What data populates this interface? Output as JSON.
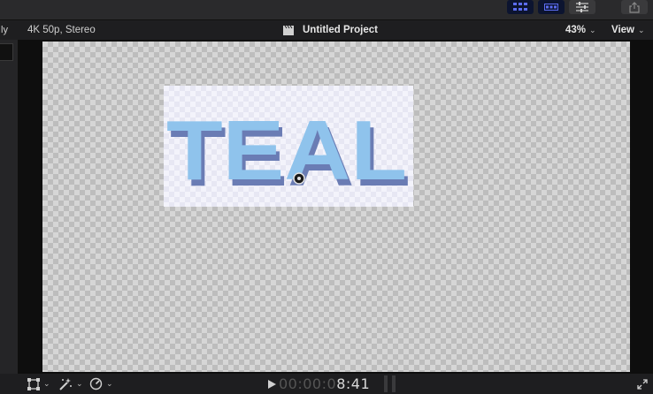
{
  "colors": {
    "accent": "#5b6cf0",
    "title_text": "#8fc3ec",
    "title_side": "#6a7cb4"
  },
  "toolbar": {
    "icons": [
      "browser-grid-icon",
      "timeline-grid-icon",
      "inspector-sliders-icon",
      "share-icon"
    ]
  },
  "sidebar": {
    "cut_label": "ly"
  },
  "viewer": {
    "format": "4K 50p, Stereo",
    "project_title": "Untitled Project",
    "zoom": "43%",
    "view_menu": "View",
    "title_text": "TEAL"
  },
  "transport": {
    "timecode_dim": "00:00:0",
    "timecode_bright": "8:41"
  }
}
